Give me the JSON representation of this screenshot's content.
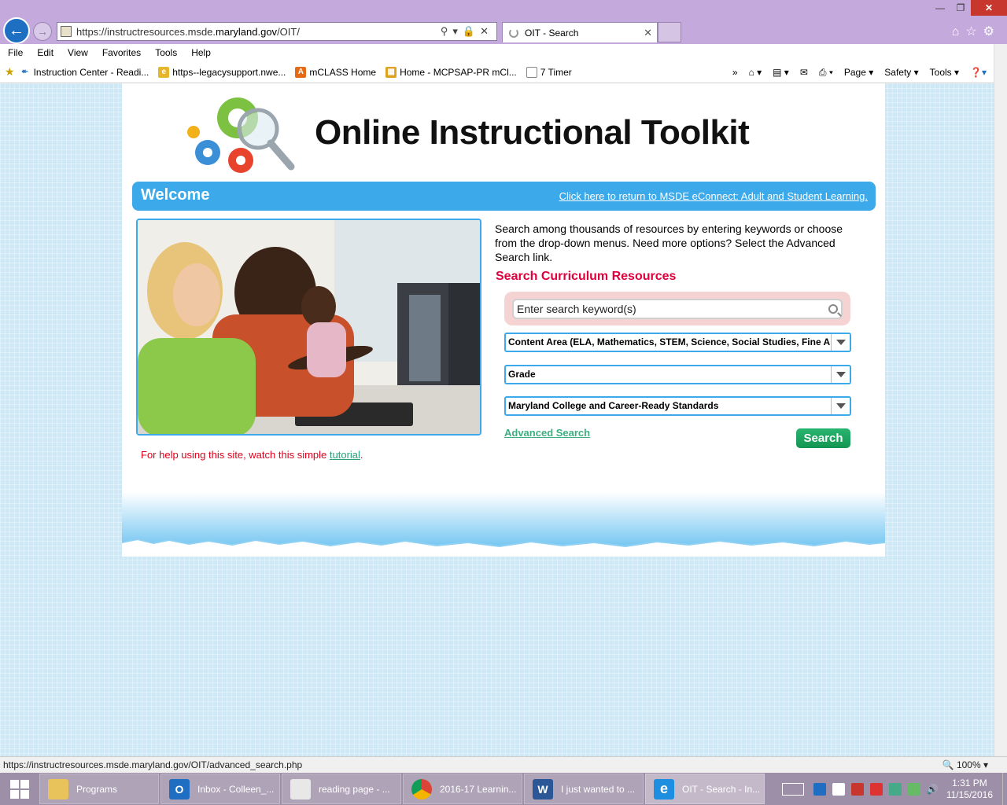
{
  "browser": {
    "url_prefix": "https://instructresources.msde.",
    "url_host": "maryland.gov",
    "url_suffix": "/OIT/",
    "tab_title": "OIT - Search",
    "menu": [
      "File",
      "Edit",
      "View",
      "Favorites",
      "Tools",
      "Help"
    ],
    "favorites": [
      "Instruction Center - Readi...",
      "https--legacysupport.nwe...",
      "mCLASS Home",
      "Home - MCPSAP-PR mCl...",
      "7 Timer"
    ],
    "favorites_icon_letter": "A",
    "commands": [
      "Page ▾",
      "Safety ▾",
      "Tools ▾"
    ],
    "status_url": "https://instructresources.msde.maryland.gov/OIT/advanced_search.php",
    "zoom": "100%"
  },
  "page": {
    "logo_title": "Online Instructional Toolkit",
    "welcome": "Welcome",
    "return_link": "Click here to return to MSDE eConnect: Adult and Student Learning.",
    "intro": "Search among thousands of resources by entering keywords or choose from the drop-down menus. Need more options? Select the Advanced Search link.",
    "heading": "Search Curriculum Resources",
    "search_placeholder": "Enter search keyword(s)",
    "dropdowns": {
      "content_area": "Content Area (ELA, Mathematics, STEM, Science, Social Studies, Fine Arts)",
      "grade": "Grade",
      "standards": "Maryland College and Career-Ready Standards"
    },
    "advanced_search": "Advanced Search",
    "search_button": "Search",
    "help_prefix": "For help using this site, watch this simple ",
    "help_link": "tutorial",
    "help_suffix": "."
  },
  "taskbar": {
    "items": [
      {
        "label": "Programs"
      },
      {
        "label": "Inbox - Colleen_..."
      },
      {
        "label": "reading page  - ..."
      },
      {
        "label": "2016-17 Learnin..."
      },
      {
        "label": "I just wanted to ..."
      },
      {
        "label": "OIT - Search - In..."
      }
    ],
    "outlook_letter": "O",
    "word_letter": "W",
    "ie_letter": "e",
    "time": "1:31 PM",
    "date": "11/15/2016"
  },
  "colors": {
    "accent_blue": "#3ba9ea",
    "heading_red": "#e0003c",
    "search_green": "#149552",
    "link_green": "#3dae82"
  }
}
